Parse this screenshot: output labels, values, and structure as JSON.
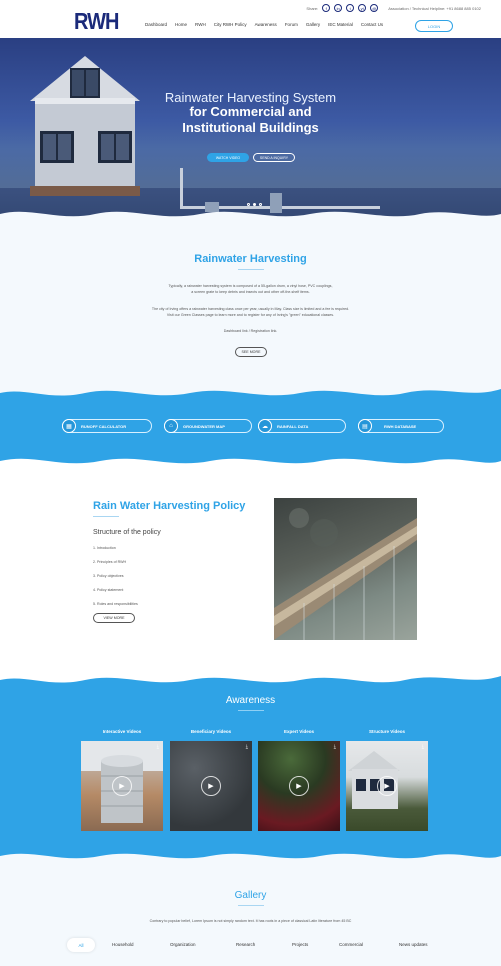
{
  "header": {
    "logo": "RWH",
    "share_label": "Share:",
    "social": [
      "f",
      "in",
      "t",
      "yt",
      "@"
    ],
    "helpline": "Association / Technical Helpline: +91 8688 885 0102",
    "nav": [
      "Dashboard",
      "Home",
      "RWH",
      "City RWH Policy",
      "Awareness",
      "Forum",
      "Gallery",
      "IEC Material",
      "Contact Us"
    ],
    "login_label": "LOGIN"
  },
  "hero": {
    "title_line1": "Rainwater Harvesting System",
    "title_line2": "for Commercial and",
    "title_line3": "Institutional Buildings",
    "watch_label": "WATCH VIDEO",
    "enquiry_label": "SEND A INQUIRY"
  },
  "intro": {
    "title": "Rainwater Harvesting",
    "para1a": "Typically, a rainwater harvesting system is composed of a 55-gallon drum, a vinyl hose, PVC couplings,",
    "para1b": "a screen grate to keep debris and insects out and other off-the-shelf items.",
    "para2a": "The city of Irving offers a rainwater harvesting class once per year, usually in May. Class size is limited and a fee is required.",
    "para2b": "Visit our Green Classes page to learn more and to register for any of Irving's \"green\" educational classes.",
    "link_text": "Dashboard link / Registration link.",
    "button": "SEE MORE"
  },
  "band": {
    "items": [
      {
        "label": "RUNOFF CALCULATOR",
        "icon": "calculator-icon"
      },
      {
        "label": "GROUNDWATER MAP",
        "icon": "map-icon"
      },
      {
        "label": "RAINFALL DATA",
        "icon": "cloud-rain-icon"
      },
      {
        "label": "RWH DATABASE",
        "icon": "database-icon"
      }
    ]
  },
  "policy": {
    "title": "Rain Water Harvesting Policy",
    "subtitle": "Structure of the policy",
    "items": [
      "1. Introduction",
      "2. Principles of RWH",
      "3. Policy objectives",
      "4. Policy statement",
      "5. Roles and responsibilities"
    ],
    "button": "VIEW MORE"
  },
  "awareness": {
    "title": "Awareness",
    "cards": [
      {
        "label": "Interactive Videos"
      },
      {
        "label": "Beneficiary Videos"
      },
      {
        "label": "Expert Videos"
      },
      {
        "label": "Structure Videos"
      }
    ]
  },
  "gallery": {
    "title": "Gallery",
    "desc": "Contrary to popular belief, Lorem Ipsum is not simply random text. It has roots in a piece of classical Latin literature from 45 BC",
    "tabs": [
      "All",
      "Household",
      "Organization",
      "Research",
      "Projects",
      "Commercial",
      "News updates"
    ]
  },
  "colors": {
    "accent": "#2fa3e6",
    "brand": "#1b2a7a"
  }
}
